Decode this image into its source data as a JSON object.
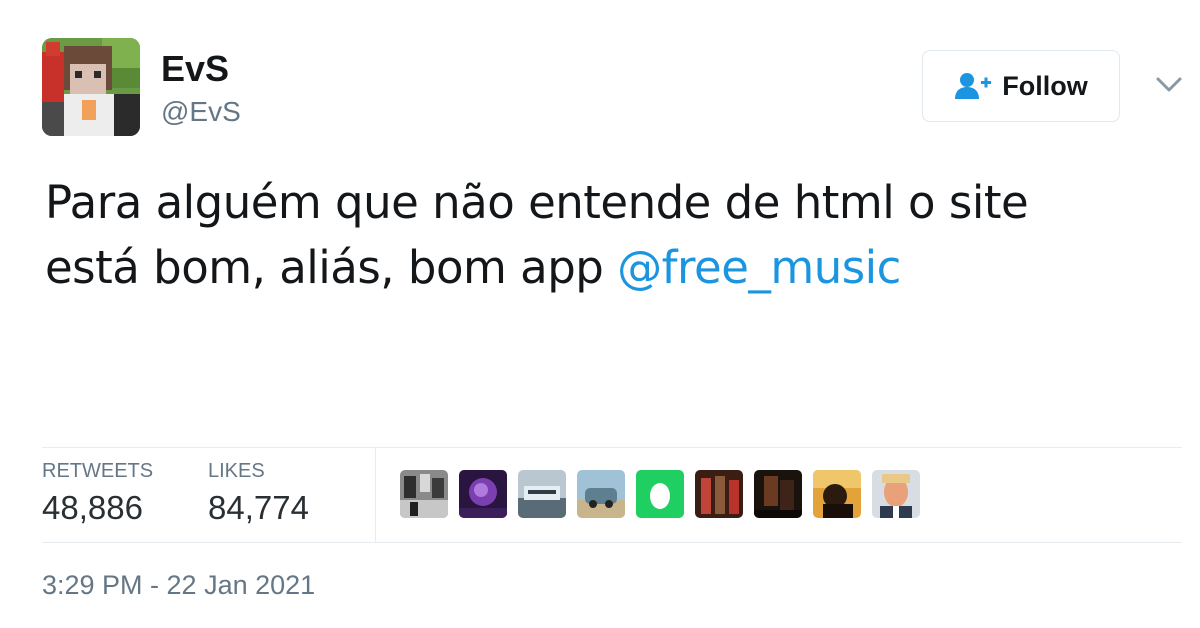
{
  "user": {
    "name": "EvS",
    "handle": "@EvS",
    "avatar_icon": "minecraft-avatar"
  },
  "follow_button": {
    "label": "Follow",
    "icon": "add-user-icon"
  },
  "menu": {
    "icon": "chevron-down-icon"
  },
  "tweet": {
    "text_line1": "Para alguém que não entende de html o site",
    "text_line2": "está bom, aliás, bom app ",
    "mention": "@free_music"
  },
  "stats": {
    "retweets_label": "RETWEETS",
    "retweets_value": "48,886",
    "likes_label": "LIKES",
    "likes_value": "84,774"
  },
  "likers": [
    {
      "icon": "liker-avatar-1"
    },
    {
      "icon": "liker-avatar-2"
    },
    {
      "icon": "liker-avatar-3"
    },
    {
      "icon": "liker-avatar-4"
    },
    {
      "icon": "liker-avatar-5-egg"
    },
    {
      "icon": "liker-avatar-6"
    },
    {
      "icon": "liker-avatar-7"
    },
    {
      "icon": "liker-avatar-8"
    },
    {
      "icon": "liker-avatar-9"
    }
  ],
  "timestamp": "3:29 PM - 22 Jan 2021",
  "colors": {
    "mention": "#1b95e0",
    "secondary_text": "#657786",
    "primary_text": "#14171a",
    "egg_green": "#1fcf62"
  }
}
